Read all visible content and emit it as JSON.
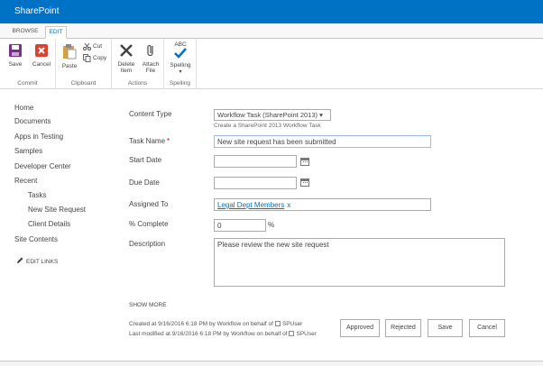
{
  "suite": {
    "brand": "SharePoint"
  },
  "tabs": [
    {
      "label": "BROWSE"
    },
    {
      "label": "EDIT"
    }
  ],
  "ribbon": {
    "commit": {
      "label": "Commit",
      "save": "Save",
      "cancel": "Cancel"
    },
    "clipboard": {
      "label": "Clipboard",
      "paste": "Paste",
      "cut": "Cut",
      "copy": "Copy"
    },
    "actions": {
      "label": "Actions",
      "delete_item": "Delete Item",
      "attach_file": "Attach File"
    },
    "spelling": {
      "label": "Spelling",
      "button": "Spelling",
      "abc": "ABC"
    }
  },
  "leftnav": {
    "items": [
      {
        "label": "Home"
      },
      {
        "label": "Documents"
      },
      {
        "label": "Apps in Testing"
      },
      {
        "label": "Samples"
      },
      {
        "label": "Developer Center"
      },
      {
        "label": "Recent"
      },
      {
        "label": "Tasks"
      },
      {
        "label": "New Site Request"
      },
      {
        "label": "Client Details"
      },
      {
        "label": "Site Contents"
      }
    ],
    "edit_links": "EDIT LINKS"
  },
  "form": {
    "content_type": {
      "label": "Content Type",
      "value": "Workflow Task (SharePoint 2013) ▾",
      "hint": "Create a SharePoint 2013 Workflow Task"
    },
    "task_name": {
      "label": "Task Name",
      "required": "*",
      "value": "New site request has been submitted"
    },
    "start_date": {
      "label": "Start Date",
      "value": ""
    },
    "due_date": {
      "label": "Due Date",
      "value": ""
    },
    "assigned_to": {
      "label": "Assigned To",
      "value": "Legal Dept Members",
      "remove": "x"
    },
    "percent_complete": {
      "label": "% Complete",
      "value": "0",
      "unit": "%"
    },
    "description": {
      "label": "Description",
      "value": "Please review the new site request"
    }
  },
  "show_more": "SHOW MORE",
  "meta": {
    "created_prefix": "Created at 9/16/2016 6:18 PM  by Workflow on behalf of",
    "created_user": "SPUser",
    "modified_prefix": "Last modified at 9/16/2016 6:18 PM  by Workflow on behalf of",
    "modified_user": "SPUser"
  },
  "buttons": {
    "approved": "Approved",
    "rejected": "Rejected",
    "save": "Save",
    "cancel": "Cancel"
  },
  "colors": {
    "suite_bar": "#0072c6",
    "link": "#0072c6",
    "required": "#cc0000"
  }
}
